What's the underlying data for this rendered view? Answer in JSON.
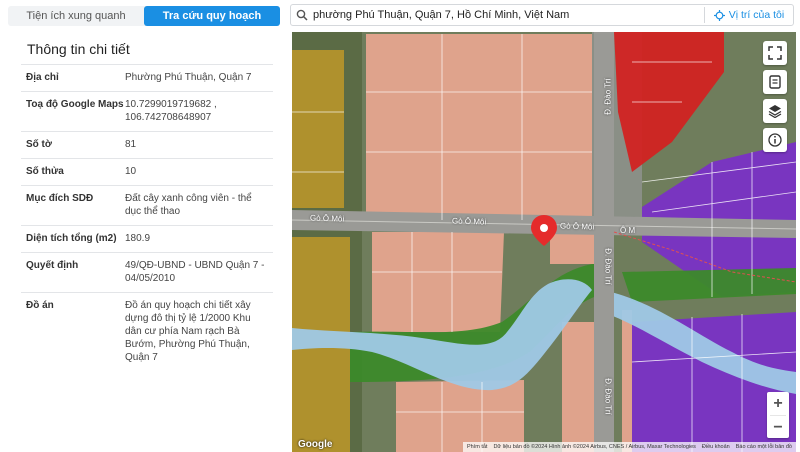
{
  "tabs": [
    {
      "label": "Tiện ích xung quanh",
      "active": false
    },
    {
      "label": "Tra cứu quy hoạch",
      "active": true
    }
  ],
  "search": {
    "value": "phường Phú Thuận, Quận 7, Hồ Chí Minh, Việt Nam",
    "icon": "search-icon",
    "location_button": "Vị trí của tôi"
  },
  "panel": {
    "title": "Thông tin chi tiết",
    "rows": [
      {
        "key": "Địa chỉ",
        "value": "Phường Phú Thuận, Quận 7"
      },
      {
        "key": "Toạ độ Google Maps",
        "value": "10.7299019719682 , 106.742708648907"
      },
      {
        "key": "Số tờ",
        "value": "81"
      },
      {
        "key": "Số thửa",
        "value": "10"
      },
      {
        "key": "Mục đích SDĐ",
        "value": "Đất cây xanh công viên - thể dục thể thao"
      },
      {
        "key": "Diện tích tổng (m2)",
        "value": "180.9"
      },
      {
        "key": "Quyết định",
        "value": "49/QĐ-UBND - UBND Quận 7 - 04/05/2010"
      },
      {
        "key": "Đồ án",
        "value": "Đồ án quy hoạch chi tiết xây dựng đô thị tỷ lệ 1/2000 Khu dân cư phía Nam rạch Bà Bướm, Phường Phú Thuận, Quận 7"
      }
    ]
  },
  "map": {
    "road_labels": [
      "Gò Ô Môi",
      "Gò Ô Môi",
      "Gò Ô Môi",
      "Đ. Đào Trí",
      "Đ. Đào Trí",
      "Đ. Đào Trí",
      "Ô M"
    ],
    "google_logo": "Google",
    "attribution": [
      "Phím tắt",
      "Dữ liệu bản đồ ©2024 Hình ảnh ©2024 Airbus, CNES / Airbus, Maxar Technologies",
      "Điều khoản",
      "Báo cáo một lỗi bản đồ"
    ],
    "controls": [
      "fullscreen-icon",
      "legend-icon",
      "layers-icon",
      "info-icon"
    ],
    "zoom_in": "+",
    "zoom_out": "−"
  },
  "colors": {
    "accent": "#1a8fe3",
    "zone_residential": "#e8a690",
    "zone_commercial": "#d42020",
    "zone_public": "#7a2fc9",
    "zone_green": "#3c8a2a",
    "zone_river": "#9fc9e6",
    "zone_agri": "#b8962a",
    "pin": "#e52b2b"
  }
}
